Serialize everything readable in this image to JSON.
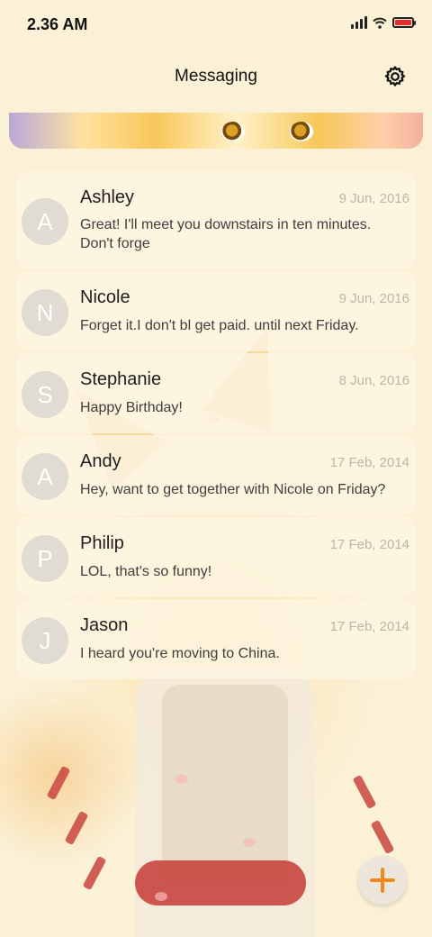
{
  "status_bar": {
    "time": "2.36 AM",
    "battery_color": "#e52b2b"
  },
  "header": {
    "title": "Messaging",
    "settings_icon": "gear-icon"
  },
  "conversations": [
    {
      "initial": "A",
      "name": "Ashley",
      "date": "9 Jun, 2016",
      "preview": "Great! I'll meet you downstairs in ten minutes. Don't forge"
    },
    {
      "initial": "N",
      "name": "Nicole",
      "date": "9 Jun, 2016",
      "preview": "Forget it.I don't bl get paid. until next Friday."
    },
    {
      "initial": "S",
      "name": "Stephanie",
      "date": "8 Jun, 2016",
      "preview": "Happy Birthday!"
    },
    {
      "initial": "A",
      "name": "Andy",
      "date": "17 Feb, 2014",
      "preview": "Hey, want to get together with Nicole on Friday?"
    },
    {
      "initial": "P",
      "name": "Philip",
      "date": "17 Feb, 2014",
      "preview": "LOL, that's so funny!"
    },
    {
      "initial": "J",
      "name": "Jason",
      "date": "17 Feb, 2014",
      "preview": "I heard you're moving to China."
    }
  ],
  "fab": {
    "icon": "plus-icon",
    "color": "#f08a1c"
  }
}
